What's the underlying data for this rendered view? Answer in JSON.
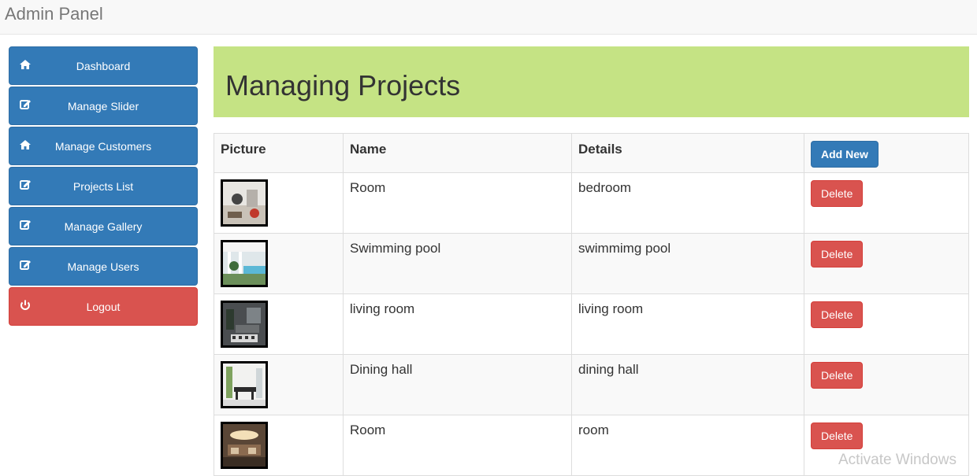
{
  "header": {
    "brand": "Admin Panel"
  },
  "sidebar": {
    "items": [
      {
        "label": "Dashboard",
        "icon": "home-icon"
      },
      {
        "label": "Manage Slider",
        "icon": "edit-icon"
      },
      {
        "label": "Manage Customers",
        "icon": "home-icon"
      },
      {
        "label": "Projects List",
        "icon": "edit-icon"
      },
      {
        "label": "Manage Gallery",
        "icon": "edit-icon"
      },
      {
        "label": "Manage Users",
        "icon": "edit-icon"
      },
      {
        "label": "Logout",
        "icon": "power-icon"
      }
    ]
  },
  "main": {
    "title": "Managing Projects",
    "table": {
      "headers": [
        "Picture",
        "Name",
        "Details"
      ],
      "add_label": "Add New",
      "delete_label": "Delete",
      "rows": [
        {
          "name": "Room",
          "details": "bedroom"
        },
        {
          "name": "Swimming pool",
          "details": "swimmimg pool"
        },
        {
          "name": "living room",
          "details": "living room"
        },
        {
          "name": "Dining hall",
          "details": "dining hall"
        },
        {
          "name": "Room",
          "details": "room"
        }
      ]
    }
  },
  "watermark": "Activate Windows",
  "colors": {
    "primary": "#337ab7",
    "danger": "#d9534f",
    "jumbotron": "#c5e384"
  }
}
